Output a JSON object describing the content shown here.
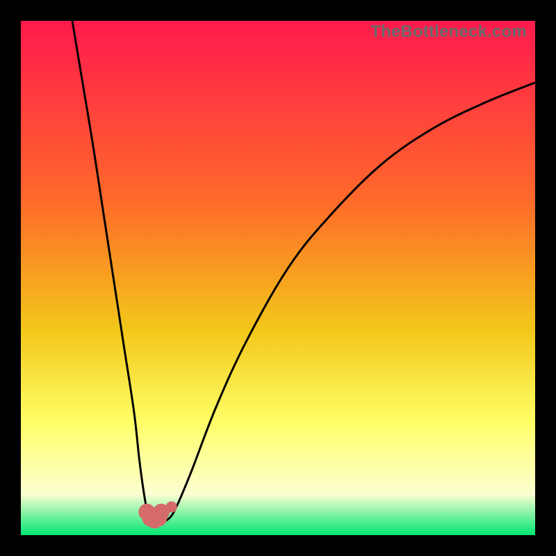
{
  "watermark": "TheBottleneck.com",
  "chart_data": {
    "type": "line",
    "title": "",
    "xlabel": "",
    "ylabel": "",
    "xlim": [
      0,
      100
    ],
    "ylim": [
      0,
      100
    ],
    "grid": false,
    "legend": false,
    "series": [
      {
        "name": "left-curve",
        "x": [
          10,
          12,
          14,
          16,
          18,
          20,
          22,
          23,
          23.8,
          24.5,
          25.2,
          26,
          26.8,
          27.3
        ],
        "y": [
          100,
          88,
          76,
          63,
          50,
          37,
          24,
          15,
          9,
          5,
          3,
          2.5,
          3,
          4
        ]
      },
      {
        "name": "right-curve",
        "x": [
          27.3,
          27.7,
          28.5,
          30,
          33,
          38,
          44,
          52,
          60,
          70,
          80,
          90,
          100
        ],
        "y": [
          4,
          3,
          3,
          5,
          12,
          25,
          38,
          52,
          62,
          72,
          79,
          84,
          88
        ]
      },
      {
        "name": "marker-cluster",
        "type": "scatter",
        "points": [
          {
            "x": 24.5,
            "y": 4.5
          },
          {
            "x": 25.2,
            "y": 3.3
          },
          {
            "x": 26.0,
            "y": 2.9
          },
          {
            "x": 26.8,
            "y": 3.3
          },
          {
            "x": 27.3,
            "y": 4.5
          },
          {
            "x": 29.3,
            "y": 5.5
          }
        ]
      }
    ],
    "gradient_colors": {
      "top": "#ff1a4d",
      "mid1": "#ff6a2a",
      "mid2": "#f2c719",
      "mid3": "#ffff66",
      "mid4": "#fbffd1",
      "bottom": "#00e673"
    },
    "marker_color": "#d46a6a",
    "curve_color": "#000000"
  }
}
